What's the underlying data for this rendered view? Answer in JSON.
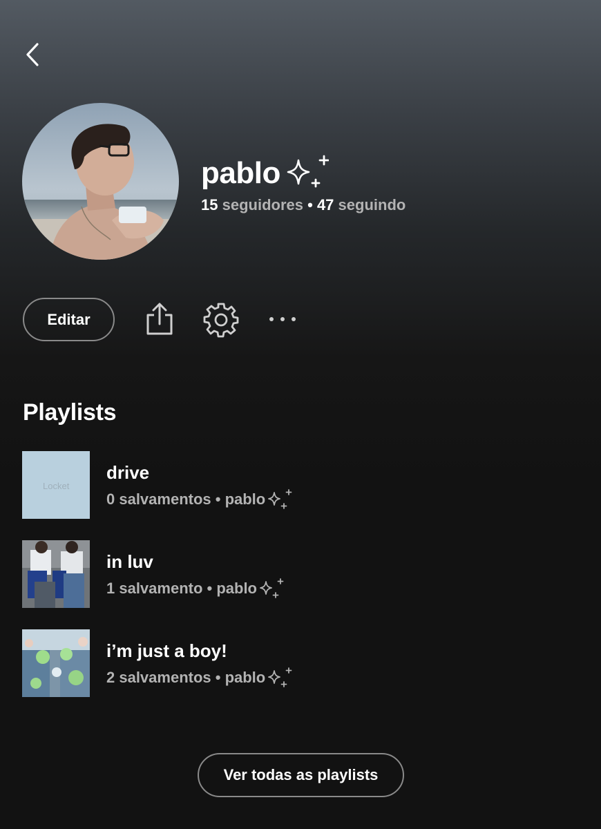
{
  "profile": {
    "name": "pablo",
    "followers_count": "15",
    "followers_label": "seguidores",
    "following_count": "47",
    "following_label": "seguindo",
    "separator": "•"
  },
  "actions": {
    "edit_label": "Editar"
  },
  "icons": {
    "back": "chevron-left-icon",
    "share": "share-icon",
    "settings": "gear-icon",
    "more": "more-horizontal-icon",
    "sparkle": "sparkle-icon"
  },
  "playlists": {
    "title": "Playlists",
    "items": [
      {
        "title": "drive",
        "meta": "0 salvamentos • pablo",
        "cover_text": "Locket"
      },
      {
        "title": "in luv",
        "meta": "1 salvamento • pablo"
      },
      {
        "title": "i’m just a boy!",
        "meta": "2 salvamentos • pablo"
      }
    ],
    "see_all_label": "Ver todas as playlists"
  },
  "colors": {
    "background_top": "#535a62",
    "background_bottom": "#121212",
    "secondary_text": "#b3b3b3",
    "button_border": "#8a8a8a"
  }
}
